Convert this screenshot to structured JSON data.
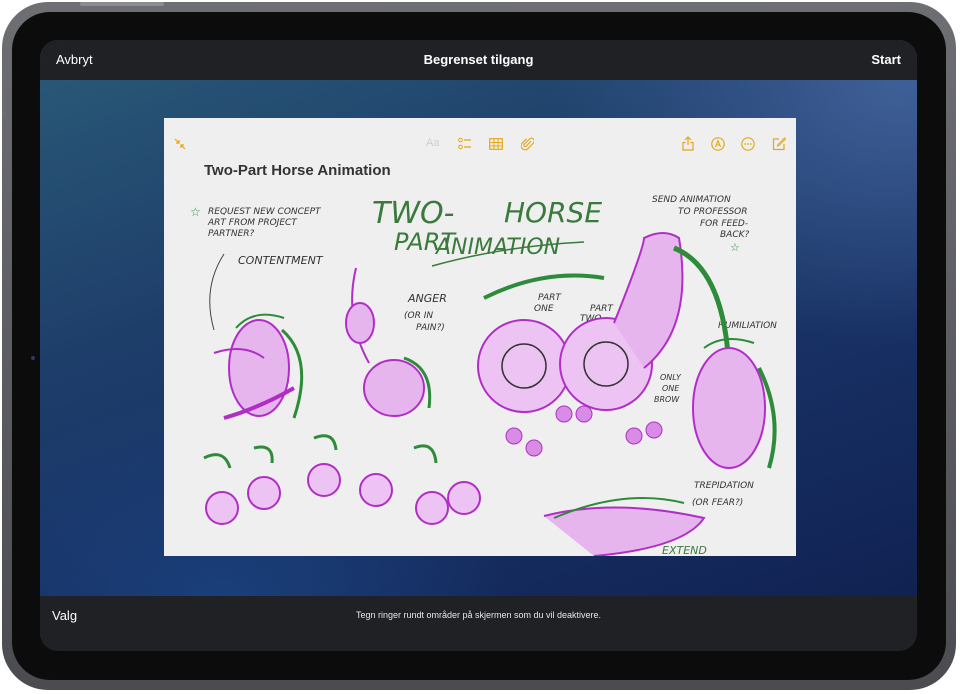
{
  "top_bar": {
    "cancel_label": "Avbryt",
    "title": "Begrenset tilgang",
    "start_label": "Start"
  },
  "bottom_bar": {
    "options_label": "Valg",
    "hint": "Tegn ringer rundt områder på skjermen som du vil deaktivere."
  },
  "note": {
    "title": "Two-Part Horse Animation",
    "font_button_label": "Aa",
    "sketch_text": {
      "headline_1": "TWO-",
      "headline_2": "PART",
      "headline_3": "HORSE",
      "headline_4": "ANIMATION",
      "request_1": "REQUEST NEW CONCEPT",
      "request_2": "ART FROM PROJECT",
      "request_3": "PARTNER?",
      "contentment": "CONTENTMENT",
      "anger_1": "ANGER",
      "anger_2": "(OR IN",
      "anger_3": "PAIN?)",
      "part_one_1": "PART",
      "part_one_2": "ONE",
      "part_two_1": "PART",
      "part_two_2": "TWO",
      "send_1": "SEND ANIMATION",
      "send_2": "TO PROFESSOR",
      "send_3": "FOR FEED-",
      "send_4": "BACK?",
      "humiliation": "HUMILIATION",
      "brow_1": "ONLY",
      "brow_2": "ONE",
      "brow_3": "BROW",
      "trepidation_1": "TREPIDATION",
      "trepidation_2": "(OR FEAR?)",
      "extend": "EXTEND"
    }
  },
  "colors": {
    "bars": "#202124",
    "accent": "#e2a81b",
    "sketch_purple": "#c43bd6",
    "sketch_green": "#2e8b3a",
    "paper": "#efefef"
  },
  "icons": [
    "collapse-icon",
    "checklist-icon",
    "table-icon",
    "attachment-icon",
    "share-icon",
    "markup-icon",
    "more-icon",
    "compose-icon"
  ]
}
